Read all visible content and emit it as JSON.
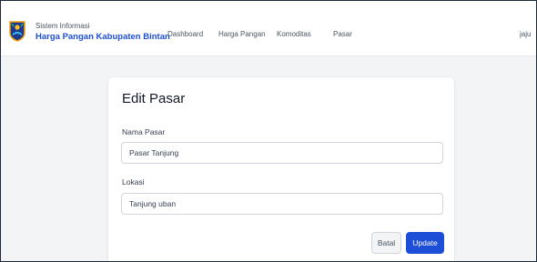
{
  "brand": {
    "subtitle": "Sistem Informasi",
    "title": "Harga Pangan Kabupaten Bintan",
    "logo_icon": "regency-emblem-icon"
  },
  "nav": {
    "items": [
      {
        "label": "Dashboard"
      },
      {
        "label": "Harga Pangan"
      },
      {
        "label": "Komoditas"
      },
      {
        "label": "Pasar"
      }
    ]
  },
  "user": {
    "name": "jaju"
  },
  "form": {
    "title": "Edit Pasar",
    "nama": {
      "label": "Nama Pasar",
      "value": "Pasar Tanjung"
    },
    "lokasi": {
      "label": "Lokasi",
      "value": "Tanjung uban"
    },
    "cancel_label": "Batal",
    "submit_label": "Update"
  },
  "colors": {
    "accent": "#1d4ed8",
    "background": "#f3f4f6",
    "card": "#ffffff"
  }
}
